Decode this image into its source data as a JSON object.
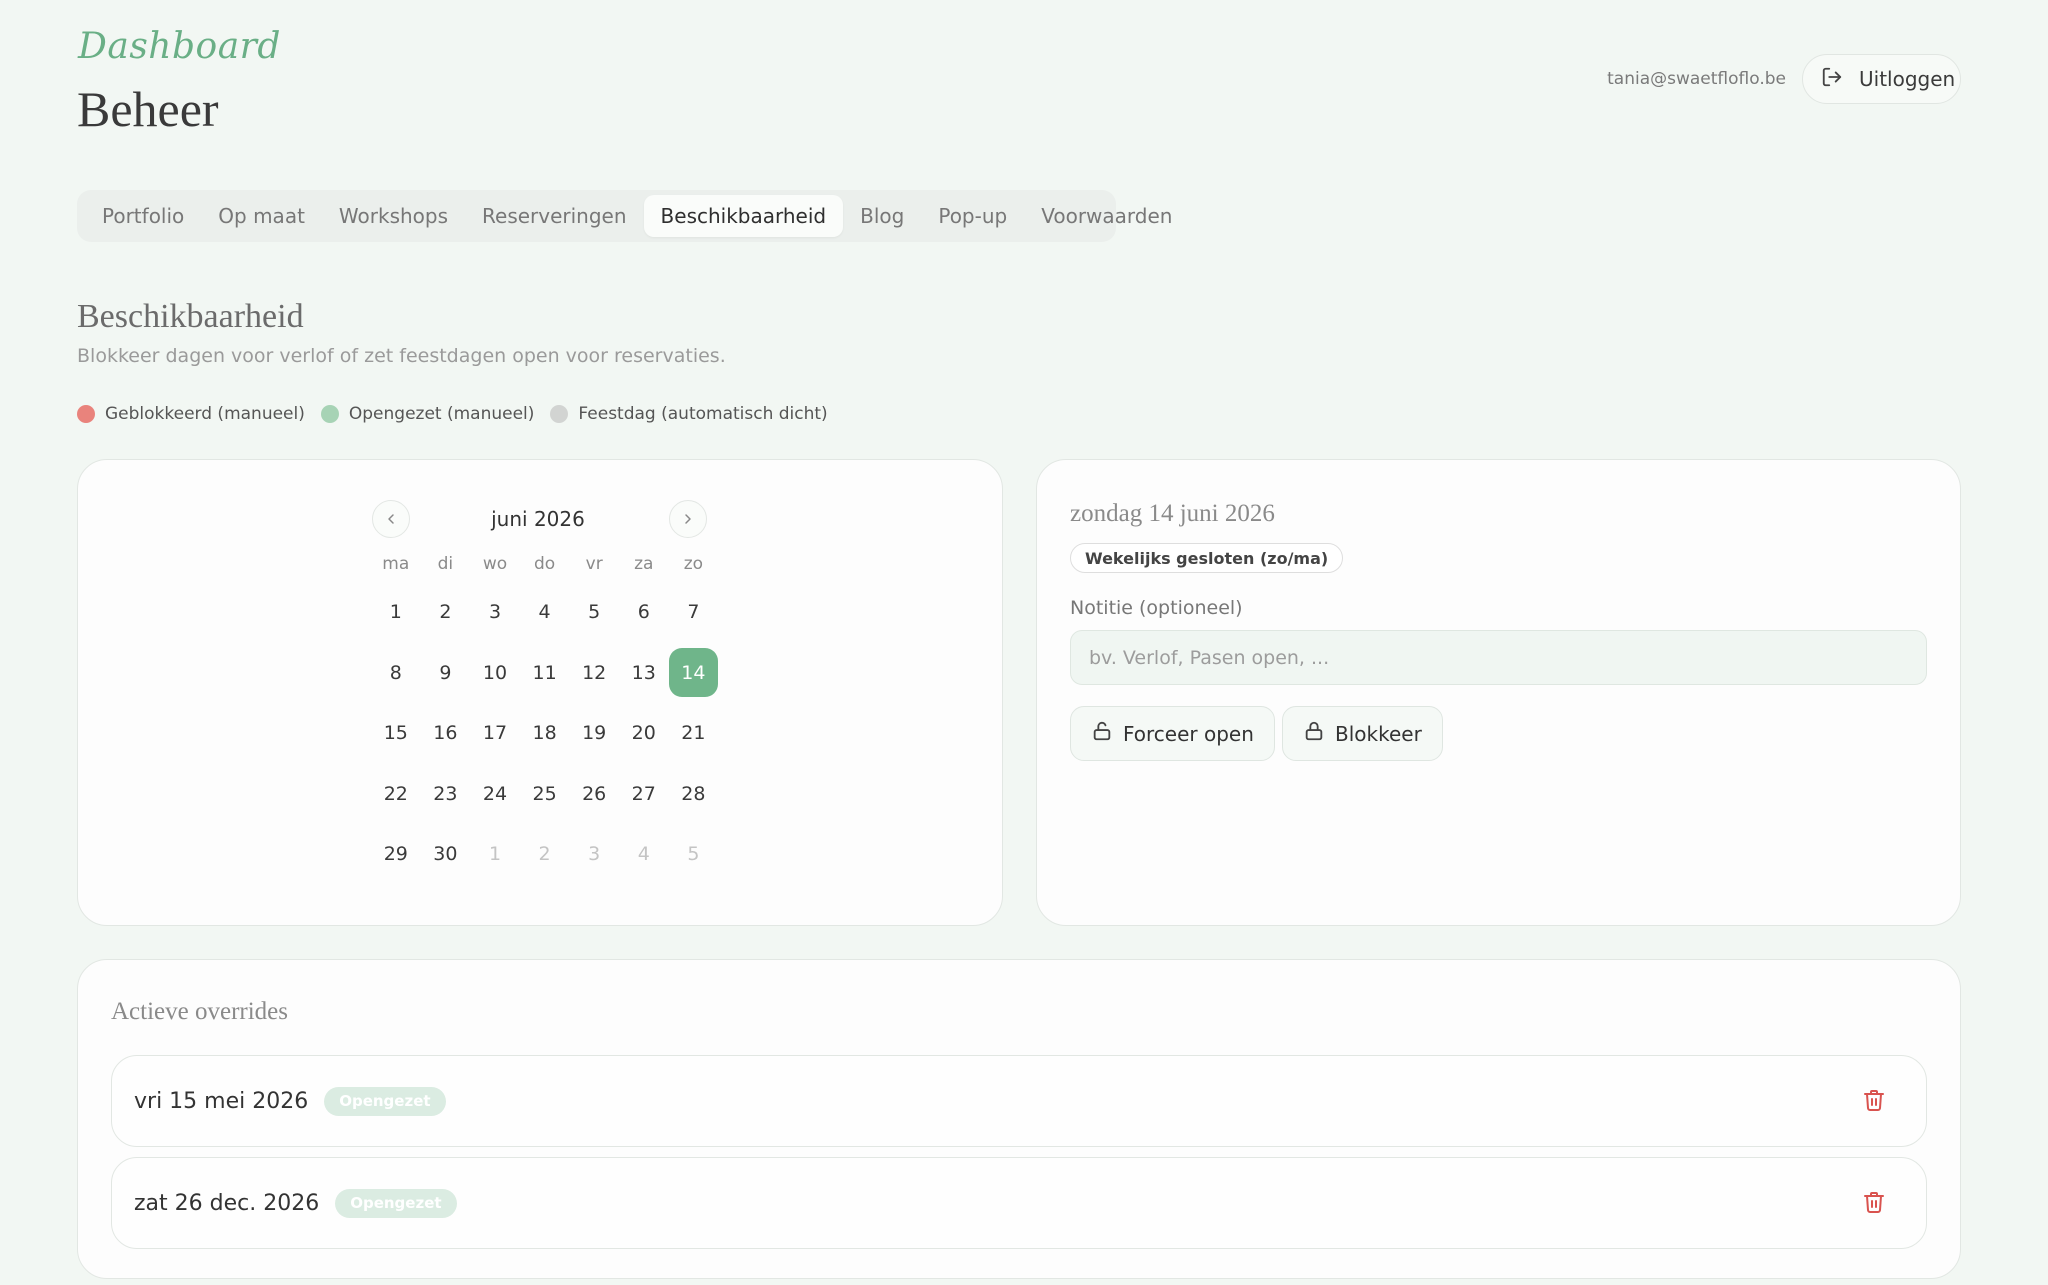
{
  "header": {
    "brand_script": "Dashboard",
    "title": "Beheer",
    "user_email": "tania@swaetfloflo.be",
    "logout_label": "Uitloggen"
  },
  "tabs": [
    {
      "label": "Portfolio",
      "active": false
    },
    {
      "label": "Op maat",
      "active": false
    },
    {
      "label": "Workshops",
      "active": false
    },
    {
      "label": "Reserveringen",
      "active": false
    },
    {
      "label": "Beschikbaarheid",
      "active": true
    },
    {
      "label": "Blog",
      "active": false
    },
    {
      "label": "Pop-up",
      "active": false
    },
    {
      "label": "Voorwaarden",
      "active": false
    }
  ],
  "section": {
    "title": "Beschikbaarheid",
    "subtitle": "Blokkeer dagen voor verlof of zet feestdagen open voor reservaties."
  },
  "legend": [
    {
      "label": "Geblokkeerd (manueel)",
      "color": "#e9837c"
    },
    {
      "label": "Opengezet (manueel)",
      "color": "#a7d3b5"
    },
    {
      "label": "Feestdag (automatisch dicht)",
      "color": "#d2d4d2"
    }
  ],
  "calendar": {
    "month_label": "juni 2026",
    "weekdays": [
      "ma",
      "di",
      "wo",
      "do",
      "vr",
      "za",
      "zo"
    ],
    "days": [
      {
        "d": "1"
      },
      {
        "d": "2"
      },
      {
        "d": "3"
      },
      {
        "d": "4"
      },
      {
        "d": "5"
      },
      {
        "d": "6"
      },
      {
        "d": "7"
      },
      {
        "d": "8"
      },
      {
        "d": "9"
      },
      {
        "d": "10"
      },
      {
        "d": "11"
      },
      {
        "d": "12"
      },
      {
        "d": "13"
      },
      {
        "d": "14",
        "selected": true
      },
      {
        "d": "15"
      },
      {
        "d": "16"
      },
      {
        "d": "17"
      },
      {
        "d": "18"
      },
      {
        "d": "19"
      },
      {
        "d": "20"
      },
      {
        "d": "21"
      },
      {
        "d": "22"
      },
      {
        "d": "23"
      },
      {
        "d": "24"
      },
      {
        "d": "25"
      },
      {
        "d": "26"
      },
      {
        "d": "27"
      },
      {
        "d": "28"
      },
      {
        "d": "29"
      },
      {
        "d": "30"
      },
      {
        "d": "1",
        "muted": true
      },
      {
        "d": "2",
        "muted": true
      },
      {
        "d": "3",
        "muted": true
      },
      {
        "d": "4",
        "muted": true
      },
      {
        "d": "5",
        "muted": true
      }
    ],
    "selected_color": "#6fb58a"
  },
  "detail": {
    "date_label": "zondag 14 juni 2026",
    "status_badge": "Wekelijks gesloten (zo/ma)",
    "note_label": "Notitie (optioneel)",
    "note_value": "",
    "note_placeholder": "bv. Verlof, Pasen open, ...",
    "force_open_label": "Forceer open",
    "block_label": "Blokkeer"
  },
  "overrides": {
    "title": "Actieve overrides",
    "items": [
      {
        "date": "vri 15 mei 2026",
        "status": "Opengezet"
      },
      {
        "date": "zat 26 dec. 2026",
        "status": "Opengezet"
      }
    ],
    "delete_color": "#d9534f"
  }
}
